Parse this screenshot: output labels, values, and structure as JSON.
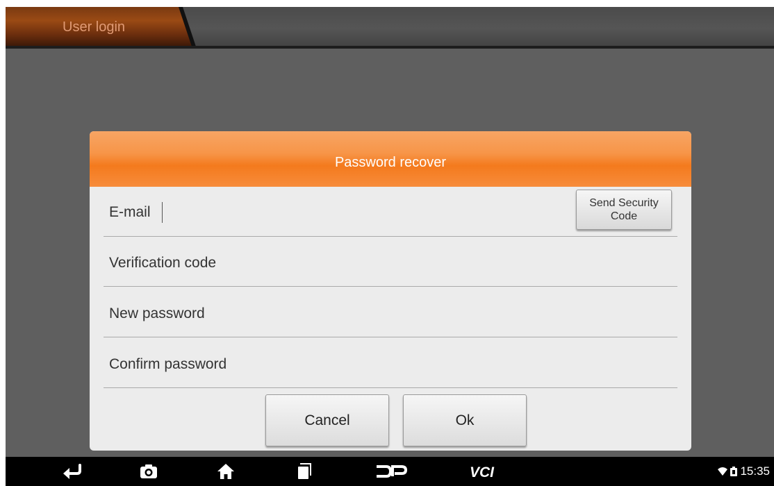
{
  "header": {
    "tab_label": "User login"
  },
  "dialog": {
    "title": "Password recover",
    "fields": [
      {
        "label": "E-mail"
      },
      {
        "label": "Verification code"
      },
      {
        "label": "New password"
      },
      {
        "label": "Confirm password"
      }
    ],
    "send_code_label": "Send Security\nCode",
    "cancel_label": "Cancel",
    "ok_label": "Ok"
  },
  "navbar": {
    "icons": [
      "back-icon",
      "camera-icon",
      "home-icon",
      "recent-apps-icon",
      "dp-logo-icon",
      "vci-icon"
    ],
    "dp_text": "DP",
    "vci_text": "VCI",
    "time": "15:35"
  },
  "colors": {
    "accent": "#f47a1d",
    "dialog_bg": "#ececec",
    "overlay": "#5f5f5f"
  }
}
